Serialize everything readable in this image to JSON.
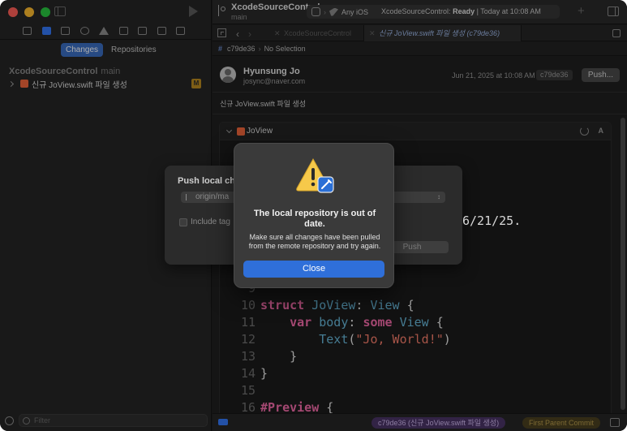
{
  "sidebar": {
    "tabs": [
      "Changes",
      "Repositories"
    ],
    "repo_name": "XcodeSourceControl",
    "repo_branch": "main",
    "commit_item": "신규 JoView.swift 파일 생성",
    "commit_badge": "M",
    "filter_placeholder": "Filter"
  },
  "toolbar": {
    "project_title": "XcodeSourceControl",
    "project_branch": "main",
    "destination": "Any iOS",
    "status_project": "XcodeSourceControl:",
    "status_state": "Ready",
    "status_time": "| Today at 10:08 AM",
    "plus_label": "+"
  },
  "tabs": {
    "inactive": "XcodeSourceControl",
    "active": "신규 JoView.swift 파일 생성 (c79de36)"
  },
  "jumpbar": {
    "hash": "#",
    "commit": "c79de36",
    "selection": "No Selection"
  },
  "commit": {
    "author": "Hyunsung Jo",
    "email": "josync@naver.com",
    "date": "Jun 21, 2025 at 10:08 AM",
    "hash": "c79de36",
    "push_label": "Push...",
    "message": "신규 JoView.swift 파일 생성"
  },
  "file": {
    "name": "JoView",
    "status": "A"
  },
  "code_lines": [
    {
      "n": "9",
      "text": ""
    },
    {
      "n": "10",
      "text": "struct JoView: View {"
    },
    {
      "n": "11",
      "text": "    var body: some View {"
    },
    {
      "n": "12",
      "text": "        Text(\"Jo, World!\")"
    },
    {
      "n": "13",
      "text": "    }"
    },
    {
      "n": "14",
      "text": "}"
    },
    {
      "n": "15",
      "text": ""
    },
    {
      "n": "16",
      "text": "#Preview {"
    }
  ],
  "code_fragment": "6/21/25.",
  "bottom_bar": {
    "commit_pill": "c79de36 (신규 JoView.swift 파일 생성)",
    "parent_pill": "First Parent Commit"
  },
  "push_sheet": {
    "title": "Push local cha",
    "remote": "origin/ma",
    "include_tags": "Include tag",
    "push_label": "Push"
  },
  "alert": {
    "title": "The local repository is out of date.",
    "message": "Make sure all changes have been pulled from the remote repository and try again.",
    "close_label": "Close"
  },
  "colors": {
    "accent": "#3478f6",
    "alert_button": "#2f6fd9",
    "keyword": "#f26aa8",
    "type": "#67b7d9",
    "string": "#f77d6a",
    "commit_pill": "#4a3466",
    "parent_pill": "#4a4020"
  }
}
